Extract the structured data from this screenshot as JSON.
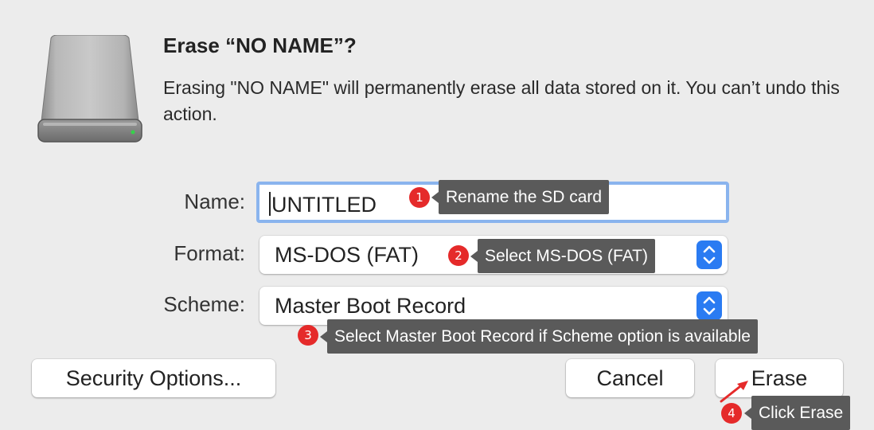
{
  "dialog": {
    "title": "Erase “NO NAME”?",
    "message": "Erasing \"NO NAME\" will permanently erase all data stored on it. You can’t undo this action.",
    "icon": "external-drive-icon"
  },
  "form": {
    "name_label": "Name:",
    "name_value": "UNTITLED",
    "format_label": "Format:",
    "format_value": "MS-DOS (FAT)",
    "scheme_label": "Scheme:",
    "scheme_value": "Master Boot Record"
  },
  "buttons": {
    "security": "Security Options...",
    "cancel": "Cancel",
    "erase": "Erase"
  },
  "annotations": [
    {
      "number": "1",
      "text": "Rename the SD card"
    },
    {
      "number": "2",
      "text": "Select MS-DOS (FAT)"
    },
    {
      "number": "3",
      "text": "Select Master Boot Record if Scheme option is available"
    },
    {
      "number": "4",
      "text": "Click Erase"
    }
  ],
  "colors": {
    "accent": "#2a7bf2",
    "focus_ring": "#8ab4ee",
    "badge": "#e52a2a",
    "tooltip": "#5a5a5a"
  }
}
